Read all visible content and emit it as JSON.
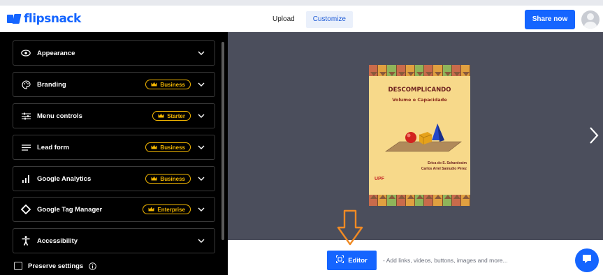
{
  "app": {
    "logo_text": "flipsnack"
  },
  "header": {
    "tabs": [
      {
        "label": "Upload",
        "active": false
      },
      {
        "label": "Customize",
        "active": true
      }
    ],
    "share_label": "Share now"
  },
  "sidebar": {
    "items": [
      {
        "label": "Appearance",
        "icon": "eye-icon",
        "badge": ""
      },
      {
        "label": "Branding",
        "icon": "palette-icon",
        "badge": "Business"
      },
      {
        "label": "Menu controls",
        "icon": "sliders-icon",
        "badge": "Starter"
      },
      {
        "label": "Lead form",
        "icon": "lines-icon",
        "badge": "Business"
      },
      {
        "label": "Google Analytics",
        "icon": "bar-chart-icon",
        "badge": "Business"
      },
      {
        "label": "Google Tag Manager",
        "icon": "diamond-icon",
        "badge": "Enterprise"
      },
      {
        "label": "Accessibility",
        "icon": "accessibility-icon",
        "badge": ""
      }
    ],
    "preserve_label": "Preserve settings",
    "preserve_checked": false
  },
  "preview": {
    "book": {
      "title": "DESCOMPLICANDO",
      "subtitle": "Volume e Capacidade",
      "author_1": "Erica do S. Schardosim",
      "author_2": "Carlos Ariel Samudio Pérez",
      "logo": "UPF"
    }
  },
  "bottom": {
    "editor_label": "Editor",
    "editor_hint": "- Add links, videos, buttons, images and more..."
  },
  "colors": {
    "brand": "#1565ff",
    "badge": "#f5b800",
    "sidebar_bg": "#000000",
    "preview_bg": "#4b4e5c",
    "annotation_arrow": "#f08a24"
  }
}
